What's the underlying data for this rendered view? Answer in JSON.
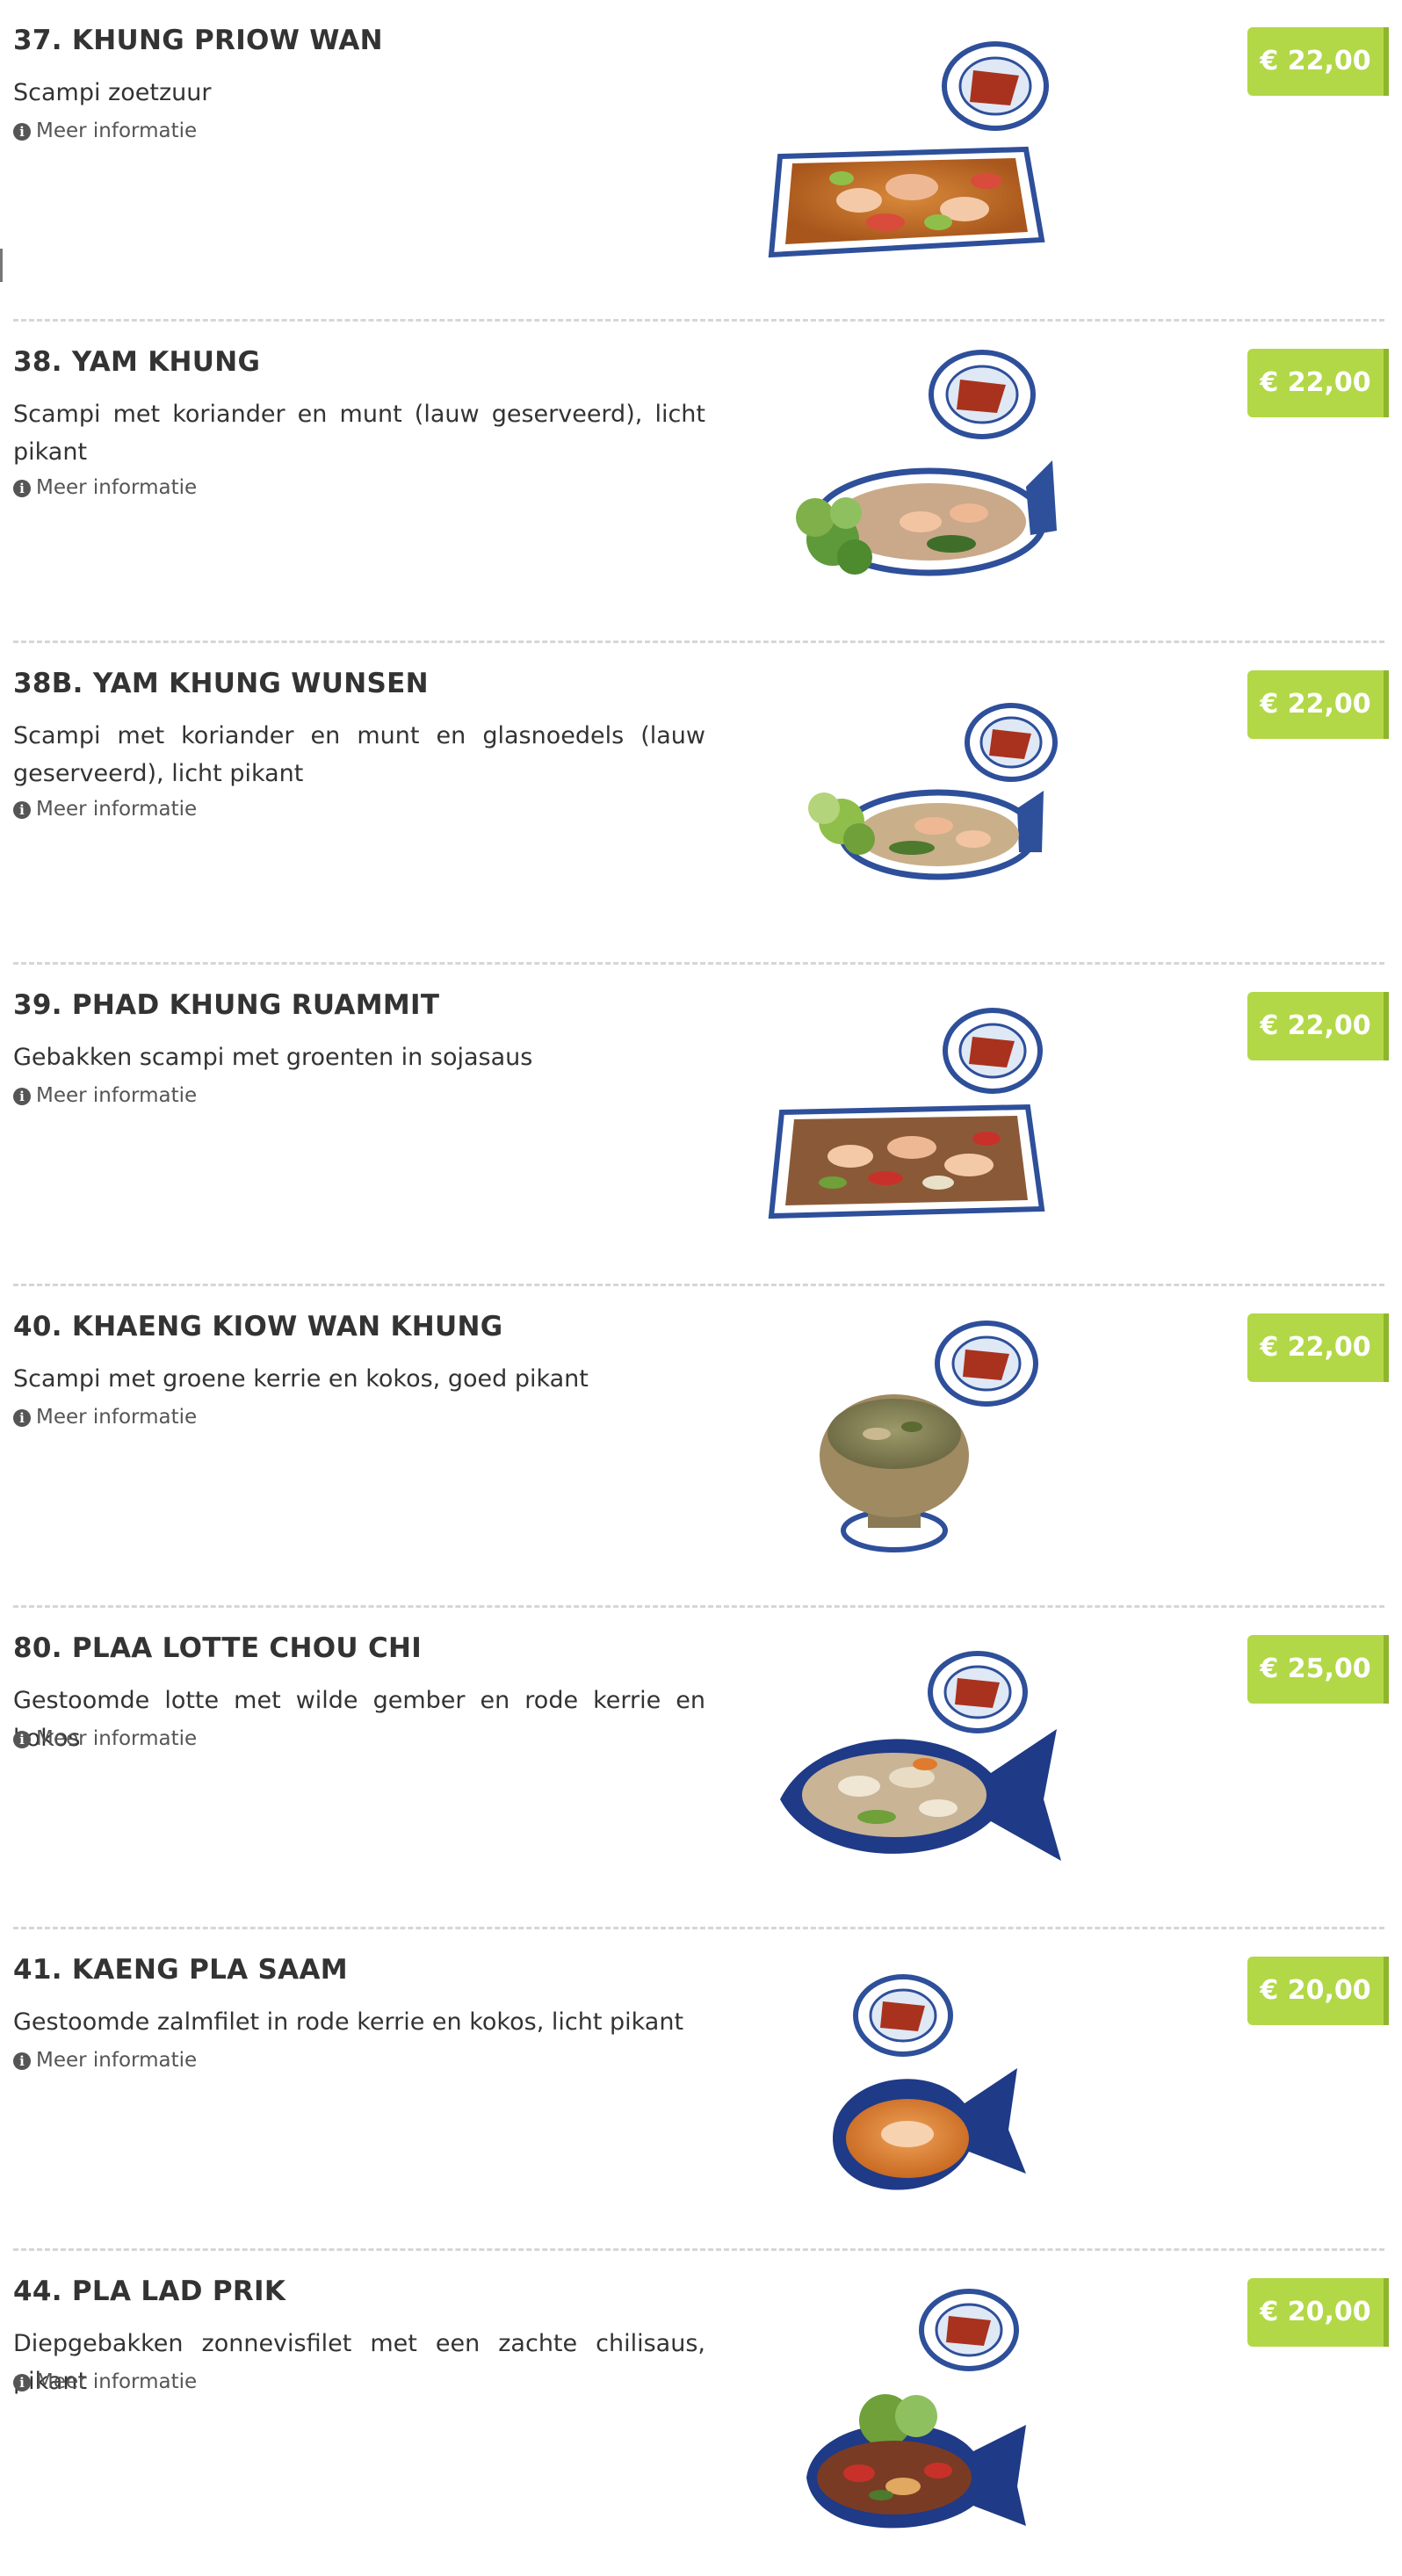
{
  "more_info_label": "Meer informatie",
  "colors": {
    "price_background": "#b2d847",
    "price_edge": "#8fb52d",
    "divider": "#d6d6d6",
    "text": "#333333"
  },
  "items": [
    {
      "title": "37. KHUNG PRIOW WAN",
      "description": "Scampi zoetzuur",
      "price": "€ 22,00",
      "photo": "rectangular platter of sweet-sour scampi with a small sauce dish"
    },
    {
      "title": "38. YAM KHUNG",
      "description": "Scampi met koriander en munt (lauw geserveerd), licht pikant",
      "price": "€ 22,00",
      "photo": "oval fish plate with scampi salad and greens"
    },
    {
      "title": "38B. YAM KHUNG WUNSEN",
      "description": "Scampi met koriander en munt en glasnoedels (lauw geserveerd), licht pikant",
      "price": "€ 22,00",
      "photo": "oval plate with scampi, glass noodles and sprouts"
    },
    {
      "title": "39. PHAD KHUNG RUAMMIT",
      "description": "Gebakken scampi met groenten in sojasaus",
      "price": "€ 22,00",
      "photo": "rectangular platter with fried scampi and vegetables"
    },
    {
      "title": "40. KHAENG KIOW WAN KHUNG",
      "description": "Scampi met groene kerrie en kokos, goed pikant",
      "price": "€ 22,00",
      "photo": "clay bowl of green curry on a blue plate"
    },
    {
      "title": "80. PLAA LOTTE CHOU CHI",
      "description": "Gestoomde lotte met wilde gember en rode kerrie en kokos",
      "price": "€ 25,00",
      "photo": "fish-shaped blue plate with steamed monkfish"
    },
    {
      "title": "41. KAENG PLA SAAM",
      "description": "Gestoomde zalmfilet in rode kerrie en kokos, licht pikant",
      "price": "€ 20,00",
      "photo": "fish-shaped blue plate with salmon in red curry"
    },
    {
      "title": "44. PLA LAD PRIK",
      "description": "Diepgebakken zonnevisfilet met een zachte chilisaus, pikant",
      "price": "€ 20,00",
      "photo": "fish-shaped blue plate with fried fish and chili sauce"
    }
  ]
}
